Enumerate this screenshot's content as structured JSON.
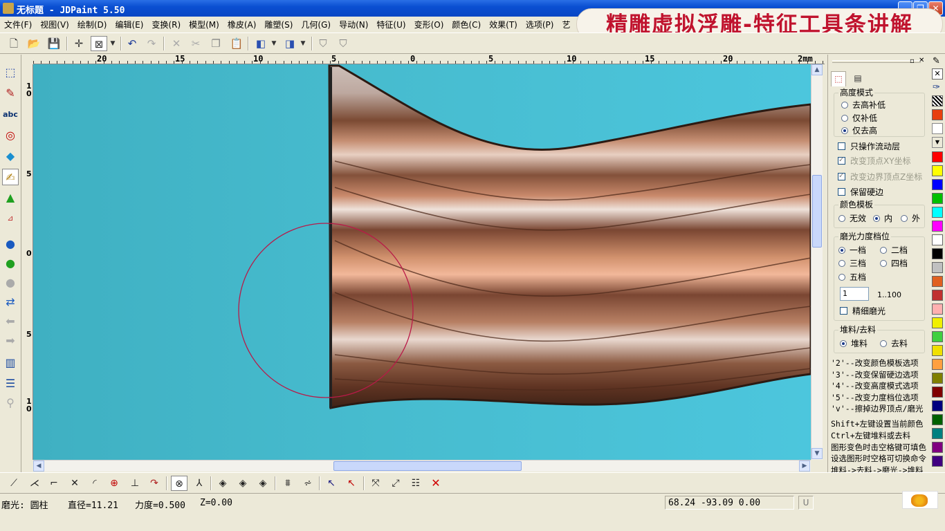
{
  "window": {
    "title": "无标题 - JDPaint 5.50"
  },
  "banner": {
    "text": "精雕虚拟浮雕-特征工具条讲解"
  },
  "menu": [
    "文件(F)",
    "视图(V)",
    "绘制(D)",
    "编辑(E)",
    "变换(R)",
    "模型(M)",
    "橡皮(A)",
    "雕塑(S)",
    "几何(G)",
    "导动(N)",
    "特征(U)",
    "变形(O)",
    "颜色(C)",
    "效果(T)",
    "选项(P)",
    "艺"
  ],
  "toolbar": {
    "icons": [
      "new-file-icon",
      "open-folder-icon",
      "save-icon",
      "crosshair-icon",
      "zoom-box-icon",
      "undo-icon",
      "redo-icon",
      "cut-icon",
      "scissors-icon",
      "copy-icon",
      "paste-icon",
      "box-icon",
      "box-wire-icon",
      "shield-icon",
      "shield2-icon"
    ]
  },
  "ruler": {
    "h_labels": [
      "20",
      "15",
      "10",
      "5",
      "0",
      "5",
      "10",
      "15",
      "20",
      "2mm"
    ],
    "v_labels": [
      "1\n0",
      "5",
      "0",
      "5",
      "1\n0"
    ]
  },
  "panel": {
    "height_mode": {
      "caption": "高度模式",
      "options": [
        "去高补低",
        "仅补低",
        "仅去高"
      ],
      "selected": 2
    },
    "checks": [
      {
        "label": "只操作流动层",
        "checked": false,
        "disabled": false
      },
      {
        "label": "改变顶点XY坐标",
        "checked": true,
        "disabled": true
      },
      {
        "label": "改变边界顶点Z坐标",
        "checked": true,
        "disabled": true
      },
      {
        "label": "保留硬边",
        "checked": false,
        "disabled": false
      }
    ],
    "color_template": {
      "caption": "颜色模板",
      "options": [
        "无效",
        "内",
        "外"
      ],
      "selected": 1
    },
    "polish": {
      "caption": "磨光力度档位",
      "options": [
        "一档",
        "二档",
        "三档",
        "四档",
        "五档"
      ],
      "selected": 0,
      "value": "1",
      "range": "1..100",
      "fine_label": "精细磨光",
      "fine_checked": false
    },
    "stock": {
      "caption": "堆料/去料",
      "options": [
        "堆料",
        "去料"
      ],
      "selected": 0
    },
    "notes": [
      "'2'--改变颜色模板选项",
      "'3'--改变保留硬边选项",
      "'4'--改变高度模式选项",
      "'5'--改变力度档位选项",
      "'v'--擦掉边界顶点/磨光",
      "Shift+左键设置当前颜色",
      "Ctrl+左键堆料或去料",
      "图形变色时击空格键可填色",
      "设选图形时空格可切换命令",
      "堆料->去料->磨光->堆料"
    ]
  },
  "palette": [
    "#ff0000",
    "#ffff00",
    "#0000ff",
    "#00c000",
    "#00ffff",
    "#ff00ff",
    "#ffffff",
    "#000000",
    "#c0c0c0",
    "#e06020",
    "#c03030",
    "#ffb0b0",
    "#f0f000",
    "#40d040",
    "#f0e000",
    "#ffa040",
    "#808000",
    "#800000",
    "#00007f",
    "#006000",
    "#008080",
    "#800080",
    "#400080"
  ],
  "status": {
    "tool": "磨光: 圆柱",
    "diameter": "直径=11.21",
    "force": "力度=0.500",
    "z": "Z=0.00",
    "coords": "68.24 -93.09 0.00",
    "mode": "U"
  }
}
